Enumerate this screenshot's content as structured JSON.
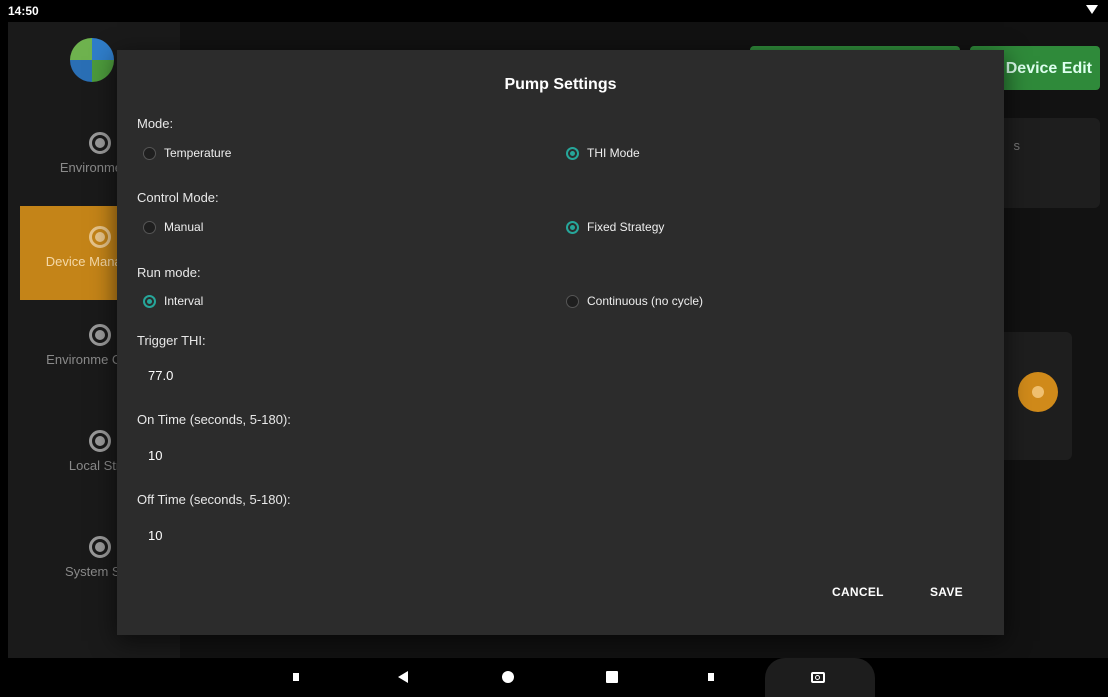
{
  "statusbar": {
    "time": "14:50"
  },
  "sidebar": {
    "items": [
      {
        "label": "Environmenta",
        "active": false
      },
      {
        "label": "Device Manageme",
        "active": true
      },
      {
        "label": "Environme Control",
        "active": false
      },
      {
        "label": "Local Strat",
        "active": false
      },
      {
        "label": "System Sett",
        "active": false
      }
    ]
  },
  "background": {
    "device_edit_label": "Device Edit",
    "card_text": "s"
  },
  "dialog": {
    "title": "Pump Settings",
    "mode": {
      "label": "Mode:",
      "options": [
        "Temperature",
        "THI Mode"
      ],
      "selected": "THI Mode"
    },
    "control_mode": {
      "label": "Control Mode:",
      "options": [
        "Manual",
        "Fixed Strategy"
      ],
      "selected": "Fixed Strategy"
    },
    "run_mode": {
      "label": "Run mode:",
      "options": [
        "Interval",
        "Continuous (no cycle)"
      ],
      "selected": "Interval"
    },
    "trigger_thi": {
      "label": "Trigger THI:",
      "value": "77.0"
    },
    "on_time": {
      "label": "On Time (seconds, 5-180):",
      "value": "10"
    },
    "off_time": {
      "label": "Off Time (seconds, 5-180):",
      "value": "10"
    },
    "cancel_label": "CANCEL",
    "save_label": "SAVE",
    "accent_color": "#26a69a"
  }
}
